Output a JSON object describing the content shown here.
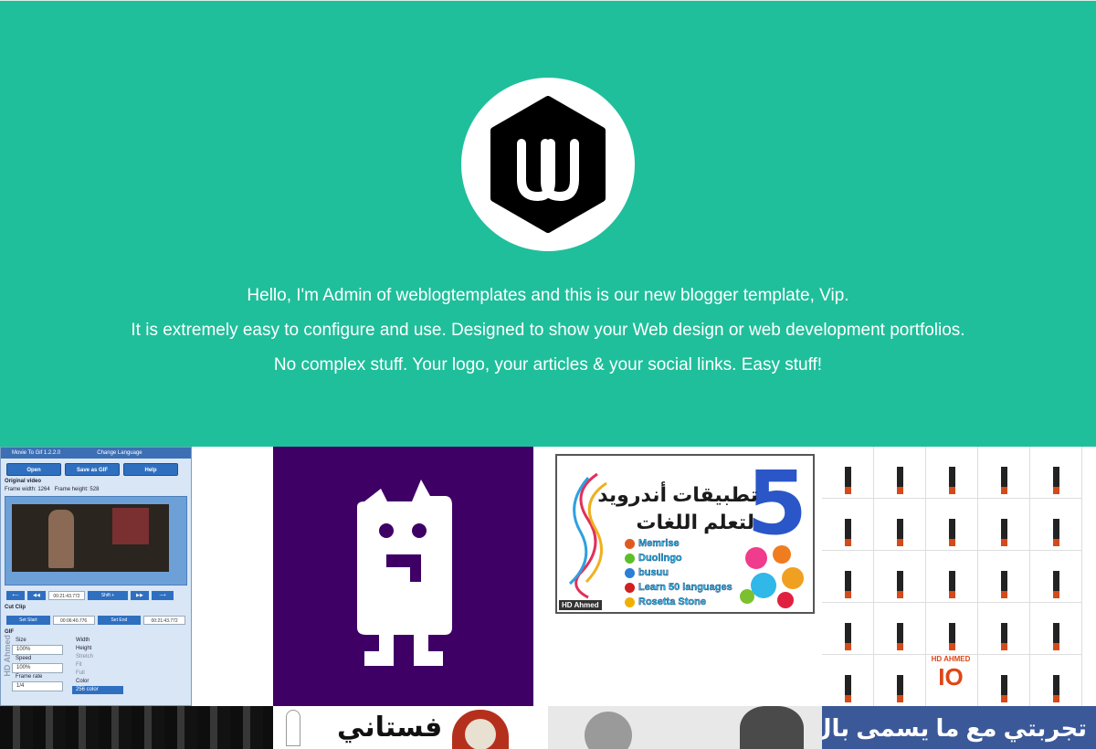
{
  "hero": {
    "background_color": "#1fbf9b",
    "logo_icon": "weblog-w-hexagon-icon",
    "intro_lines": [
      "Hello, I'm Admin of weblogtemplates and this is our new blogger template, Vip.",
      "It is extremely easy to configure and use. Designed to show your Web design or web development portfolios.",
      "No complex stuff. Your logo, your articles & your social links. Easy stuff!"
    ]
  },
  "portfolio": {
    "tiles": [
      {
        "kind": "app-screenshot",
        "window_title": "Movie To Gif 1.2.2.0",
        "change_language": "Change Language",
        "buttons": [
          "Open",
          "Save as GIF",
          "Help"
        ],
        "original_video": "Original video",
        "frame_width": "Frame width: 1264",
        "frame_height": "Frame height: 528",
        "time_start": "00:21:43.772",
        "shift": "Shift +",
        "cut_clip": "Cut Clip",
        "set_start": "Set Start",
        "start_value": "00:06:40.776",
        "set_end": "Set End",
        "end_value": "00:21:43.772",
        "gif": "GIF",
        "size_label": "Size",
        "size_value": "100%",
        "speed_label": "Speed",
        "speed_value": "100%",
        "frame_rate_label": "Frame rate",
        "frame_rate_value": "1/4",
        "color_label": "Color",
        "color_value": "256 color",
        "width_label": "Width",
        "height_label": "Height",
        "stretch_options": [
          "Stretch",
          "Fit",
          "Full"
        ],
        "watermark": "HD Ahmed"
      },
      {
        "kind": "monster-illustration",
        "background_color": "#3f0066"
      },
      {
        "kind": "poster",
        "number": "5",
        "title_line_1": "تطبيقات أندرويد",
        "title_line_2": "لتعلم اللغات",
        "apps": [
          "Memrise",
          "Duolingo",
          "busuu",
          "Learn 50 languages",
          "Rosetta Stone"
        ],
        "credit": "HD Ahmed"
      },
      {
        "kind": "pencil-carvings",
        "badge_caption": "HD AHMED",
        "badge_text": "IO"
      }
    ],
    "bottom_tiles": [
      {
        "kind": "dark-photo",
        "text": ""
      },
      {
        "kind": "poster",
        "text": "فستاني"
      },
      {
        "kind": "photo",
        "text": ""
      },
      {
        "kind": "facebook-banner",
        "text": "تجربتي مع ما يسمى بال",
        "background_color": "#3b5998"
      }
    ]
  }
}
